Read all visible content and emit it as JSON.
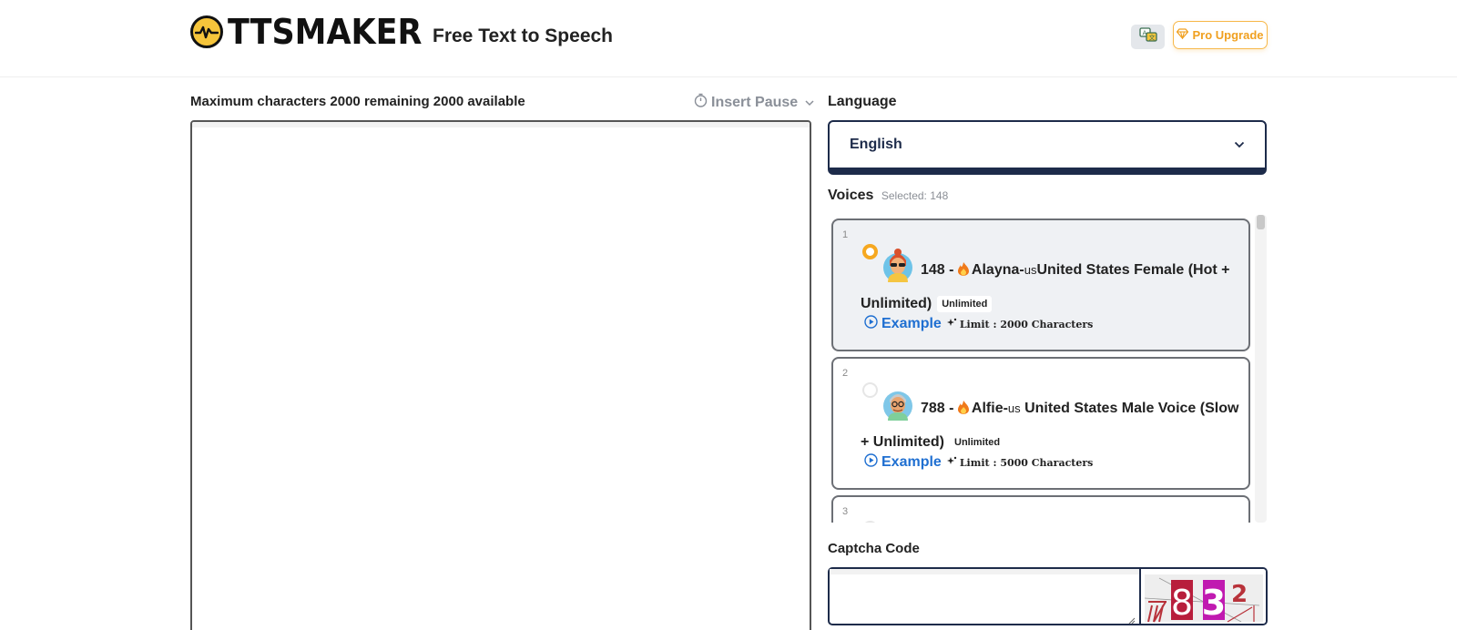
{
  "header": {
    "logo_text": "TTSMAKER",
    "tagline": "Free Text to Speech",
    "language_icon": "translate-icon",
    "pro_label": "Pro Upgrade",
    "pro_icon": "diamond-icon"
  },
  "editor": {
    "char_info": "Maximum characters 2000 remaining 2000 available",
    "insert_pause": "Insert Pause",
    "text_value": ""
  },
  "language": {
    "label": "Language",
    "selected": "English"
  },
  "voices": {
    "label": "Voices",
    "selected_text": "Selected: 148",
    "items": [
      {
        "index": "1",
        "id_prefix": "148 - ",
        "name": "Alayna-",
        "country_code": "us",
        "description": "United States Female (Hot + Unlimited)",
        "badge": "Unlimited",
        "example": "Example",
        "limit": "Limit : 2000 Characters",
        "selected": true
      },
      {
        "index": "2",
        "id_prefix": "788 - ",
        "name": "Alfie-",
        "country_code": "us",
        "description": " United States Male Voice (Slow + Unlimited)",
        "badge": "Unlimited",
        "example": "Example",
        "limit": "Limit : 5000 Characters",
        "selected": false
      },
      {
        "index": "3"
      }
    ]
  },
  "captcha": {
    "label": "Captcha Code",
    "value": "",
    "image_text": "7832"
  },
  "colors": {
    "accent_navy": "#1d2b4a",
    "pro_orange": "#f0a020",
    "example_blue": "#1f6fd1",
    "logo_yellow": "#f6c53b"
  }
}
